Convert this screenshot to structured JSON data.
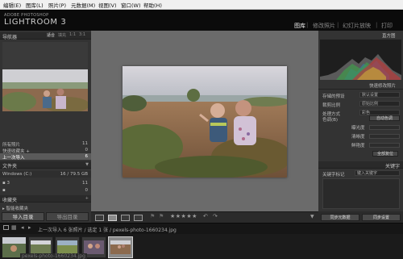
{
  "menubar": {
    "items": [
      "编辑(E)",
      "图库(L)",
      "照片(P)",
      "元数据(M)",
      "视图(V)",
      "窗口(W)",
      "帮助(H)"
    ]
  },
  "header": {
    "brand_small": "ADOBE PHOTOSHOP",
    "brand_big": "LIGHTROOM 3",
    "modules": [
      "图库",
      "修改照片",
      "幻灯片放映",
      "打印"
    ],
    "active_module": "图库"
  },
  "left_panel": {
    "navigator_title": "导航器",
    "navigator_tabs": [
      "适合",
      "填充",
      "1:1",
      "3:1"
    ],
    "navigator_active_tab": "适合",
    "catalog_rows": [
      {
        "label": "所有照片",
        "count": "11"
      },
      {
        "label": "快速收藏夹 +",
        "count": "0"
      },
      {
        "label": "上一次导入",
        "count": "6"
      }
    ],
    "catalog_selected_index": 2,
    "folders_title": "文件夹",
    "folder_volume": {
      "label": "Windows (C:)",
      "size": "16 / 79.5 GB"
    },
    "folders": [
      {
        "label": "3",
        "count": "11"
      },
      {
        "label": "",
        "count": "0"
      }
    ],
    "collections_title": "收藏夹",
    "collections": [
      {
        "label": "智能收藏夹"
      }
    ],
    "import_label": "导入目录",
    "export_label": "导出目录"
  },
  "center": {
    "toolbar": {
      "views": [
        "grid-view",
        "loupe-view",
        "compare-view",
        "survey-view"
      ],
      "active_view": "loupe-view",
      "stars": "★★★★★"
    }
  },
  "right_panel": {
    "histogram_title": "直方图",
    "quick_develop_title": "快速修改照片",
    "rows": [
      {
        "label": "存储的预设",
        "value": "默认设置"
      },
      {
        "label": "裁剪比例",
        "value": "原始比例"
      },
      {
        "label": "处理方式",
        "value": "彩色"
      }
    ],
    "white_balance_label": "色调(B)",
    "white_balance_value": "自动色调",
    "tone_rows": [
      {
        "label": "曝光度"
      },
      {
        "label": "清晰度"
      },
      {
        "label": "鲜艳度"
      }
    ],
    "reset_label": "全部复位",
    "keywords_title": "关键字",
    "keyword_label": "关键字标记",
    "keyword_value": "键入关键字",
    "sync_meta_label": "同步元数据",
    "sync_settings_label": "同步设置"
  },
  "filmstrip": {
    "path": "上一次导入  6 张照片 / 选定 1 张 / pexels-photo-1660234.jpg",
    "tooltip": "pexels-photo-1660234.jpg",
    "thumb_count": 6,
    "selected_index": 5
  },
  "colors": {
    "background": "#262626",
    "center_backdrop": "#6b6b6b",
    "selected_row": "#5a5a5a"
  }
}
